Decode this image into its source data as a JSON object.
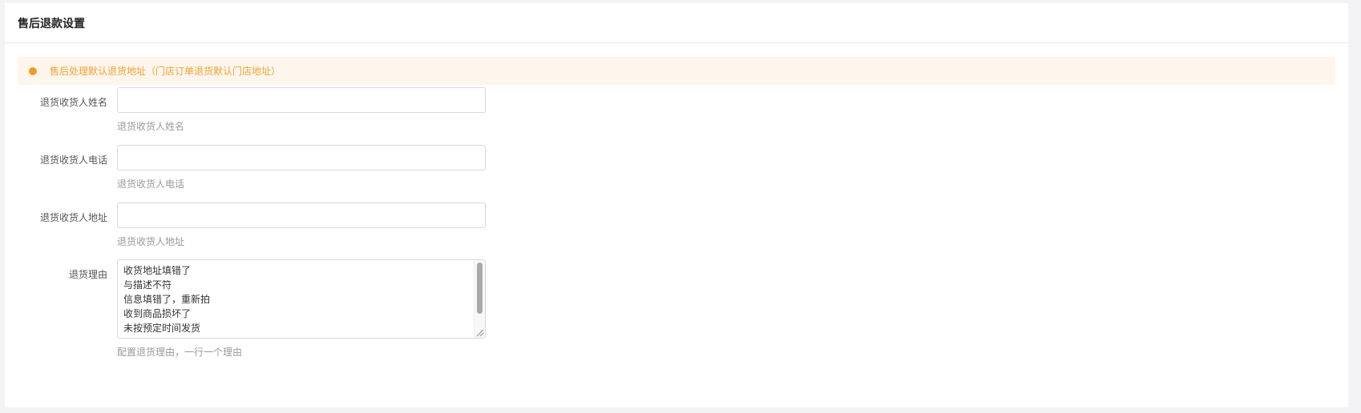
{
  "card": {
    "title": "售后退款设置"
  },
  "notice": {
    "text": "售后处理默认退货地址（门店订单退货默认门店地址）",
    "dot_color": "#f29a26"
  },
  "form": {
    "name": {
      "label": "退货收货人姓名",
      "value": "",
      "help": "退货收货人姓名"
    },
    "phone": {
      "label": "退货收货人电话",
      "value": "",
      "help": "退货收货人电话"
    },
    "address": {
      "label": "退货收货人地址",
      "value": "",
      "help": "退货收货人地址"
    },
    "reasons": {
      "label": "退货理由",
      "lines": [
        "收货地址填错了",
        "与描述不符",
        "信息填错了，重新拍",
        "收到商品损坏了",
        "未按预定时间发货"
      ],
      "help": "配置退货理由，一行一个理由"
    }
  }
}
